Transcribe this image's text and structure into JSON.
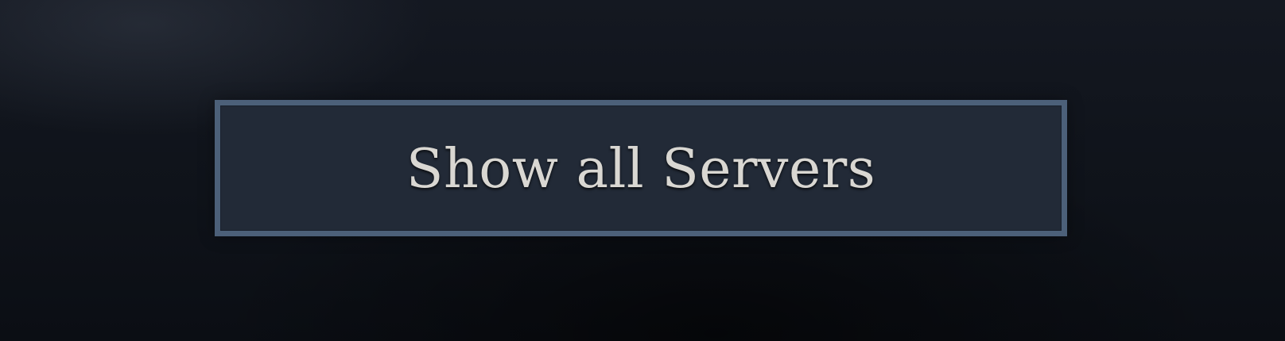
{
  "server_browser": {
    "show_all_button_label": "Show all Servers"
  },
  "colors": {
    "background": "#10141b",
    "button_fill": "#222a37",
    "button_border": "#4c6079",
    "button_text": "#d9d7d2"
  }
}
